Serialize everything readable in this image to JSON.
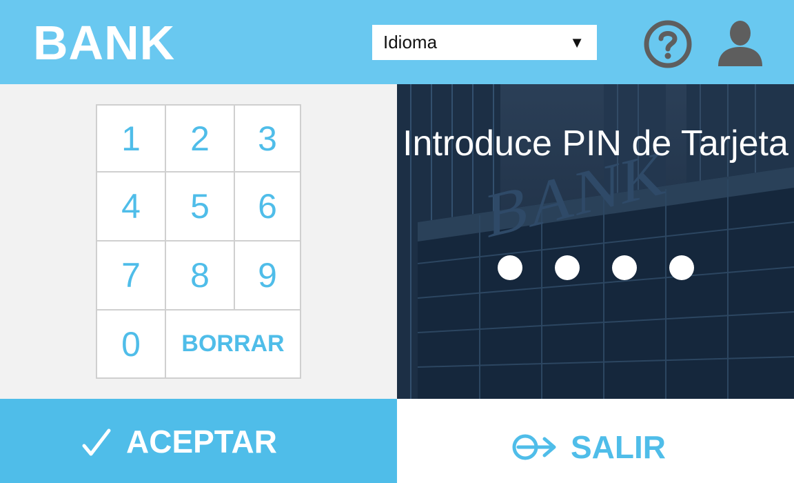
{
  "header": {
    "brand": "BANK",
    "language_select": {
      "selected": "Idioma",
      "arrow": "▼"
    },
    "icons": [
      "help-icon",
      "user-icon"
    ]
  },
  "keypad": {
    "keys": [
      "1",
      "2",
      "3",
      "4",
      "5",
      "6",
      "7",
      "8",
      "9",
      "0"
    ],
    "clear_label": "BORRAR"
  },
  "pin_entry": {
    "prompt": "Introduce PIN de Tarjeta",
    "entered_digits": 4,
    "background_sign_text": "BANK"
  },
  "actions": {
    "accept_label": "ACEPTAR",
    "accept_icon": "checkmark-icon",
    "exit_label": "SALIR",
    "exit_icon": "exit-arrow-icon"
  },
  "colors": {
    "header": "#69c8f0",
    "accent": "#4fbde9",
    "icon_gray": "#5e5e5e",
    "panel_bg": "#f2f2f2"
  }
}
